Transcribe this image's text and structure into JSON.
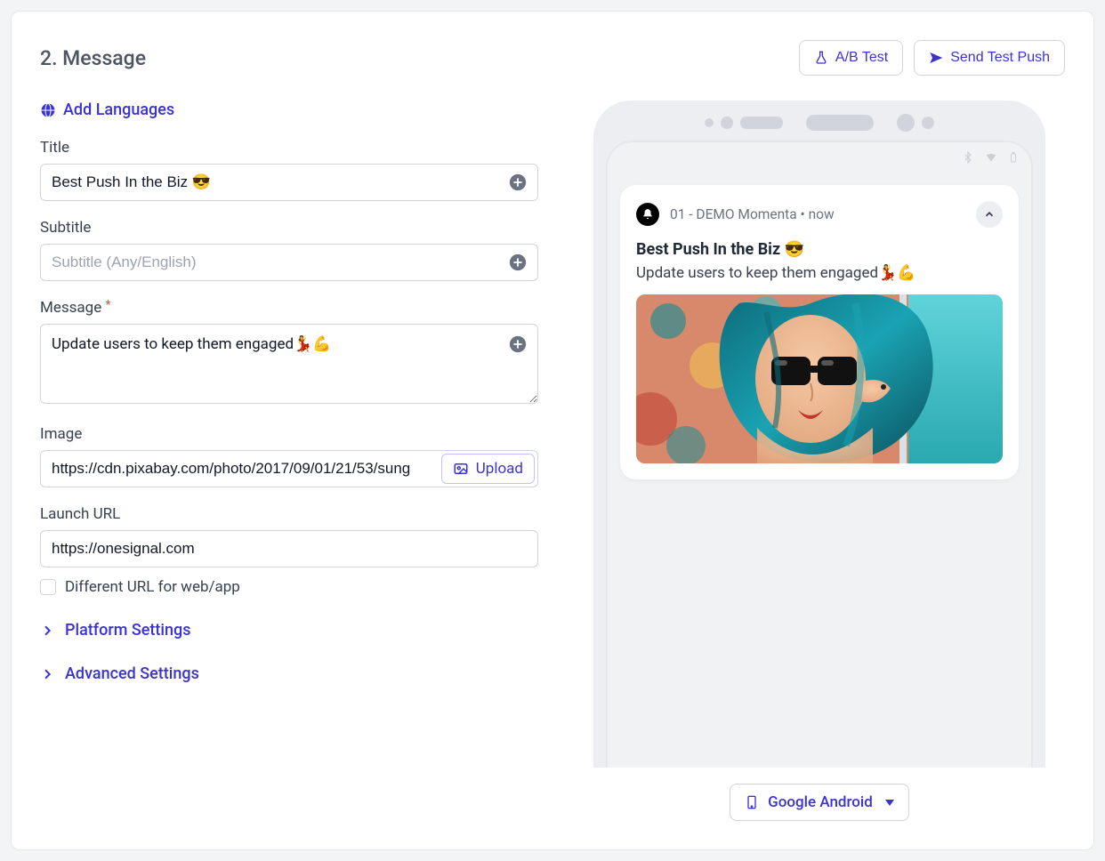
{
  "section_title": "2. Message",
  "header_actions": {
    "ab_test": "A/B Test",
    "send_test": "Send Test Push"
  },
  "add_languages": "Add Languages",
  "fields": {
    "title": {
      "label": "Title",
      "value": "Best Push In the Biz 😎"
    },
    "subtitle": {
      "label": "Subtitle",
      "placeholder": "Subtitle (Any/English)"
    },
    "message": {
      "label": "Message",
      "required": "*",
      "value": "Update users to keep them engaged💃💪"
    },
    "image": {
      "label": "Image",
      "value": "https://cdn.pixabay.com/photo/2017/09/01/21/53/sung",
      "upload": "Upload"
    },
    "launch_url": {
      "label": "Launch URL",
      "value": "https://onesignal.com"
    },
    "different_url": "Different URL for web/app"
  },
  "expanders": {
    "platform": "Platform Settings",
    "advanced": "Advanced Settings"
  },
  "preview": {
    "app_name": "01 - DEMO Momenta",
    "time_sep": "•",
    "time": "now",
    "title": "Best Push In the Biz 😎",
    "body": "Update users to keep them engaged💃💪"
  },
  "device_selector": "Google Android"
}
